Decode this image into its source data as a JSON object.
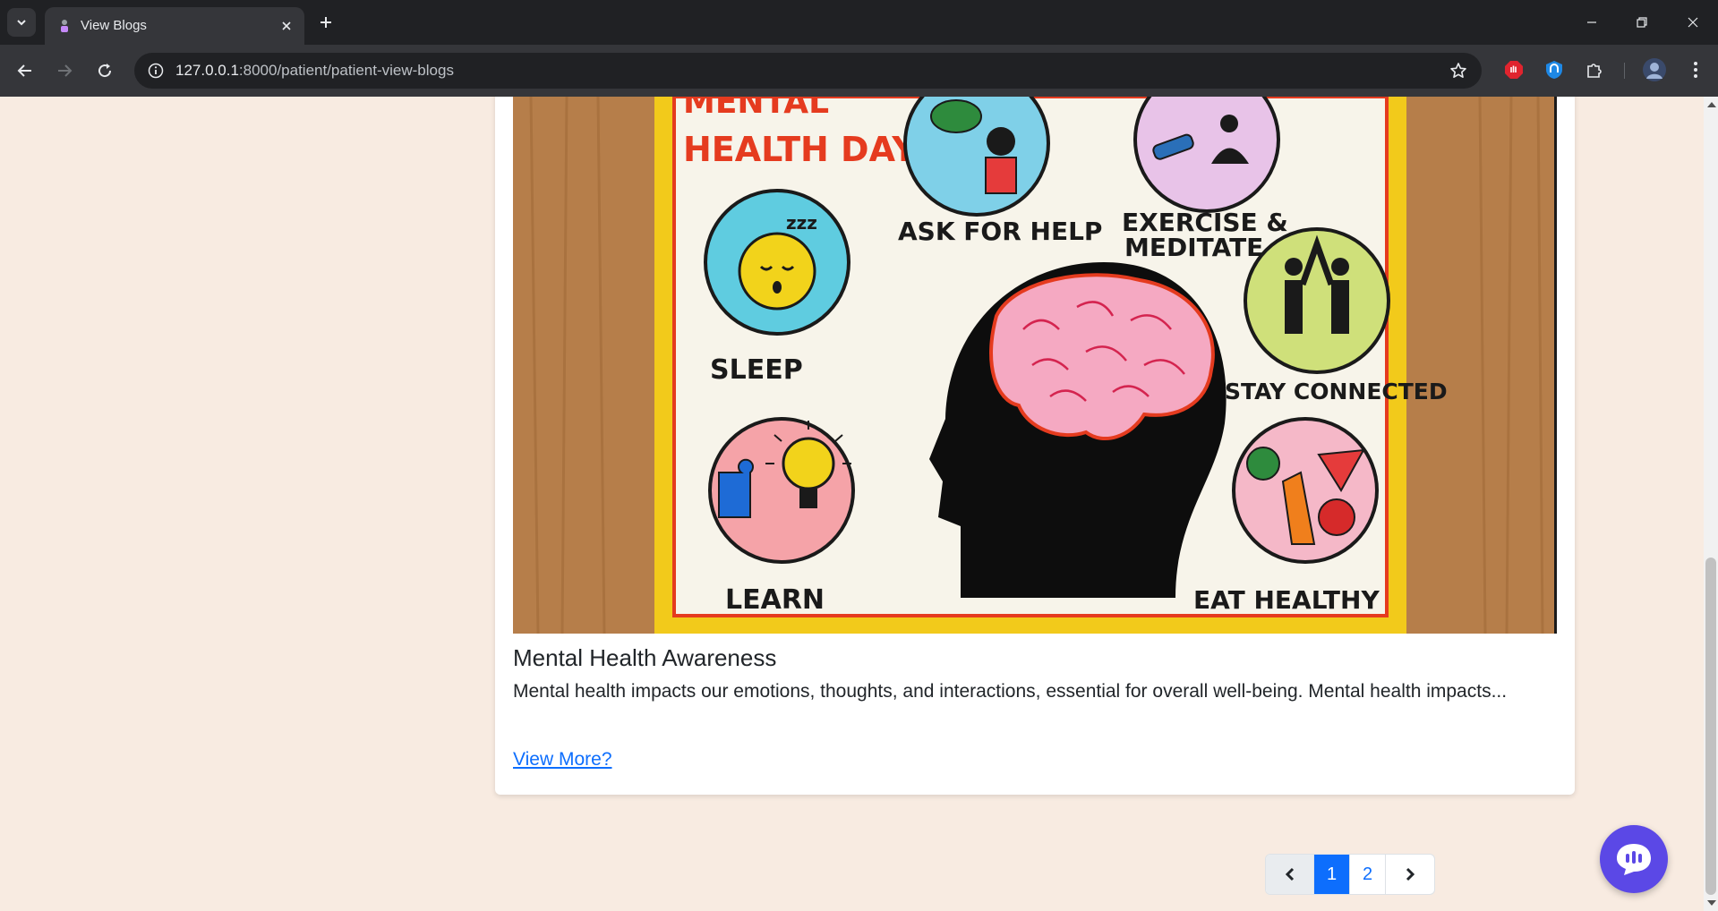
{
  "browser": {
    "tab_title": "View Blogs",
    "url_host": "127.0.0.1",
    "url_rest": ":8000/patient/patient-view-blogs"
  },
  "poster": {
    "heading_line1": "MENTAL",
    "heading_line2": "HEALTH DAY",
    "labels": {
      "sleep": "SLEEP",
      "ask_for_help": "ASK FOR HELP",
      "exercise_line1": "EXERCISE &",
      "exercise_line2": "MEDITATE",
      "stay_connected": "STAY CONNECTED",
      "learn": "LEARN",
      "eat_healthy": "EAT HEALTHY"
    }
  },
  "blog": {
    "title": "Mental Health Awareness",
    "excerpt": "Mental health impacts our emotions, thoughts, and interactions, essential for overall well-being. Mental health impacts...",
    "view_more_label": "View More?"
  },
  "pagination": {
    "prev_icon": "chevron-left-icon",
    "pages": [
      "1",
      "2"
    ],
    "active_page": "1",
    "next_icon": "chevron-right-icon"
  },
  "colors": {
    "page_background": "#f8ebe1",
    "accent": "#0d6efd",
    "chat_button": "#5b48e6"
  }
}
